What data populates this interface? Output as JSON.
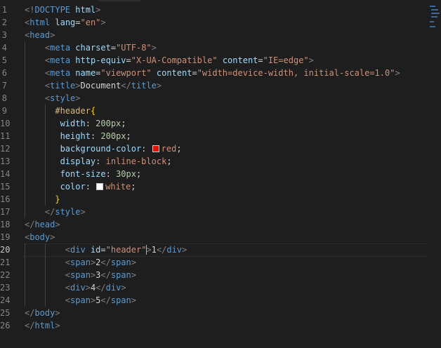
{
  "editor": {
    "active_line": 20,
    "lines": [
      {
        "n": "1",
        "tokens": [
          {
            "t": "<!",
            "c": "t-punct"
          },
          {
            "t": "DOCTYPE",
            "c": "t-doctype"
          },
          {
            "t": " html",
            "c": "t-attr"
          },
          {
            "t": ">",
            "c": "t-punct"
          }
        ]
      },
      {
        "n": "2",
        "tokens": [
          {
            "t": "<",
            "c": "t-punct"
          },
          {
            "t": "html",
            "c": "t-tag"
          },
          {
            "t": " lang",
            "c": "t-attr"
          },
          {
            "t": "=",
            "c": "t-text"
          },
          {
            "t": "\"en\"",
            "c": "t-str"
          },
          {
            "t": ">",
            "c": "t-punct"
          }
        ]
      },
      {
        "n": "3",
        "tokens": [
          {
            "t": "<",
            "c": "t-punct"
          },
          {
            "t": "head",
            "c": "t-tag"
          },
          {
            "t": ">",
            "c": "t-punct"
          }
        ]
      },
      {
        "n": "4",
        "tokens": [
          {
            "t": "    ",
            "c": "t-text"
          },
          {
            "t": "<",
            "c": "t-punct"
          },
          {
            "t": "meta",
            "c": "t-tag"
          },
          {
            "t": " charset",
            "c": "t-attr"
          },
          {
            "t": "=",
            "c": "t-text"
          },
          {
            "t": "\"UTF-8\"",
            "c": "t-str"
          },
          {
            "t": ">",
            "c": "t-punct"
          }
        ]
      },
      {
        "n": "5",
        "tokens": [
          {
            "t": "    ",
            "c": "t-text"
          },
          {
            "t": "<",
            "c": "t-punct"
          },
          {
            "t": "meta",
            "c": "t-tag"
          },
          {
            "t": " http-equiv",
            "c": "t-attr"
          },
          {
            "t": "=",
            "c": "t-text"
          },
          {
            "t": "\"X-UA-Compatible\"",
            "c": "t-str"
          },
          {
            "t": " content",
            "c": "t-attr"
          },
          {
            "t": "=",
            "c": "t-text"
          },
          {
            "t": "\"IE=edge\"",
            "c": "t-str"
          },
          {
            "t": ">",
            "c": "t-punct"
          }
        ]
      },
      {
        "n": "6",
        "tokens": [
          {
            "t": "    ",
            "c": "t-text"
          },
          {
            "t": "<",
            "c": "t-punct"
          },
          {
            "t": "meta",
            "c": "t-tag"
          },
          {
            "t": " name",
            "c": "t-attr"
          },
          {
            "t": "=",
            "c": "t-text"
          },
          {
            "t": "\"viewport\"",
            "c": "t-str"
          },
          {
            "t": " content",
            "c": "t-attr"
          },
          {
            "t": "=",
            "c": "t-text"
          },
          {
            "t": "\"width=device-width, initial-scale=1.0\"",
            "c": "t-str"
          },
          {
            "t": ">",
            "c": "t-punct"
          }
        ]
      },
      {
        "n": "7",
        "tokens": [
          {
            "t": "    ",
            "c": "t-text"
          },
          {
            "t": "<",
            "c": "t-punct"
          },
          {
            "t": "title",
            "c": "t-tag"
          },
          {
            "t": ">",
            "c": "t-punct"
          },
          {
            "t": "Document",
            "c": "t-text"
          },
          {
            "t": "</",
            "c": "t-punct"
          },
          {
            "t": "title",
            "c": "t-tag"
          },
          {
            "t": ">",
            "c": "t-punct"
          }
        ]
      },
      {
        "n": "8",
        "tokens": [
          {
            "t": "    ",
            "c": "t-text"
          },
          {
            "t": "<",
            "c": "t-punct"
          },
          {
            "t": "style",
            "c": "t-tag"
          },
          {
            "t": ">",
            "c": "t-punct"
          }
        ]
      },
      {
        "n": "9",
        "tokens": [
          {
            "t": "      ",
            "c": "t-text"
          },
          {
            "t": "#header",
            "c": "t-sel"
          },
          {
            "t": "{",
            "c": "t-brace"
          }
        ]
      },
      {
        "n": "10",
        "tokens": [
          {
            "t": "       ",
            "c": "t-text"
          },
          {
            "t": "width",
            "c": "t-prop"
          },
          {
            "t": ": ",
            "c": "t-text"
          },
          {
            "t": "200px",
            "c": "t-num"
          },
          {
            "t": ";",
            "c": "t-text"
          }
        ]
      },
      {
        "n": "11",
        "tokens": [
          {
            "t": "       ",
            "c": "t-text"
          },
          {
            "t": "height",
            "c": "t-prop"
          },
          {
            "t": ": ",
            "c": "t-text"
          },
          {
            "t": "200px",
            "c": "t-num"
          },
          {
            "t": ";",
            "c": "t-text"
          }
        ]
      },
      {
        "n": "12",
        "tokens": [
          {
            "t": "       ",
            "c": "t-text"
          },
          {
            "t": "background-color",
            "c": "t-prop"
          },
          {
            "t": ": ",
            "c": "t-text"
          },
          {
            "swatch": "#e51400"
          },
          {
            "t": "red",
            "c": "t-val"
          },
          {
            "t": ";",
            "c": "t-text"
          }
        ]
      },
      {
        "n": "13",
        "tokens": [
          {
            "t": "       ",
            "c": "t-text"
          },
          {
            "t": "display",
            "c": "t-prop"
          },
          {
            "t": ": ",
            "c": "t-text"
          },
          {
            "t": "inline-block",
            "c": "t-val"
          },
          {
            "t": ";",
            "c": "t-text"
          }
        ]
      },
      {
        "n": "14",
        "tokens": [
          {
            "t": "       ",
            "c": "t-text"
          },
          {
            "t": "font-size",
            "c": "t-prop"
          },
          {
            "t": ": ",
            "c": "t-text"
          },
          {
            "t": "30px",
            "c": "t-num"
          },
          {
            "t": ";",
            "c": "t-text"
          }
        ]
      },
      {
        "n": "15",
        "tokens": [
          {
            "t": "       ",
            "c": "t-text"
          },
          {
            "t": "color",
            "c": "t-prop"
          },
          {
            "t": ": ",
            "c": "t-text"
          },
          {
            "swatch": "#ffffff"
          },
          {
            "t": "white",
            "c": "t-val"
          },
          {
            "t": ";",
            "c": "t-text"
          }
        ]
      },
      {
        "n": "16",
        "tokens": [
          {
            "t": "      ",
            "c": "t-text"
          },
          {
            "t": "}",
            "c": "t-brace"
          }
        ]
      },
      {
        "n": "17",
        "tokens": [
          {
            "t": "    ",
            "c": "t-text"
          },
          {
            "t": "</",
            "c": "t-punct"
          },
          {
            "t": "style",
            "c": "t-tag"
          },
          {
            "t": ">",
            "c": "t-punct"
          }
        ]
      },
      {
        "n": "18",
        "tokens": [
          {
            "t": "</",
            "c": "t-punct"
          },
          {
            "t": "head",
            "c": "t-tag"
          },
          {
            "t": ">",
            "c": "t-punct"
          }
        ]
      },
      {
        "n": "19",
        "tokens": [
          {
            "t": "<",
            "c": "t-punct"
          },
          {
            "t": "body",
            "c": "t-tag"
          },
          {
            "t": ">",
            "c": "t-punct"
          }
        ]
      },
      {
        "n": "20",
        "tokens": [
          {
            "t": "        ",
            "c": "t-text"
          },
          {
            "t": "<",
            "c": "t-punct"
          },
          {
            "t": "div",
            "c": "t-tag"
          },
          {
            "t": " id",
            "c": "t-attr"
          },
          {
            "t": "=",
            "c": "t-text"
          },
          {
            "t": "\"header\"",
            "c": "t-str"
          },
          {
            "cursor": true
          },
          {
            "t": ">",
            "c": "t-punct"
          },
          {
            "t": "1",
            "c": "t-text"
          },
          {
            "t": "</",
            "c": "t-punct"
          },
          {
            "t": "div",
            "c": "t-tag"
          },
          {
            "t": ">",
            "c": "t-punct"
          }
        ]
      },
      {
        "n": "21",
        "tokens": [
          {
            "t": "        ",
            "c": "t-text"
          },
          {
            "t": "<",
            "c": "t-punct"
          },
          {
            "t": "span",
            "c": "t-tag"
          },
          {
            "t": ">",
            "c": "t-punct"
          },
          {
            "t": "2",
            "c": "t-text"
          },
          {
            "t": "</",
            "c": "t-punct"
          },
          {
            "t": "span",
            "c": "t-tag"
          },
          {
            "t": ">",
            "c": "t-punct"
          }
        ]
      },
      {
        "n": "22",
        "tokens": [
          {
            "t": "        ",
            "c": "t-text"
          },
          {
            "t": "<",
            "c": "t-punct"
          },
          {
            "t": "span",
            "c": "t-tag"
          },
          {
            "t": ">",
            "c": "t-punct"
          },
          {
            "t": "3",
            "c": "t-text"
          },
          {
            "t": "</",
            "c": "t-punct"
          },
          {
            "t": "span",
            "c": "t-tag"
          },
          {
            "t": ">",
            "c": "t-punct"
          }
        ]
      },
      {
        "n": "23",
        "tokens": [
          {
            "t": "        ",
            "c": "t-text"
          },
          {
            "t": "<",
            "c": "t-punct"
          },
          {
            "t": "div",
            "c": "t-tag"
          },
          {
            "t": ">",
            "c": "t-punct"
          },
          {
            "t": "4",
            "c": "t-text"
          },
          {
            "t": "</",
            "c": "t-punct"
          },
          {
            "t": "div",
            "c": "t-tag"
          },
          {
            "t": ">",
            "c": "t-punct"
          }
        ]
      },
      {
        "n": "24",
        "tokens": [
          {
            "t": "        ",
            "c": "t-text"
          },
          {
            "t": "<",
            "c": "t-punct"
          },
          {
            "t": "span",
            "c": "t-tag"
          },
          {
            "t": ">",
            "c": "t-punct"
          },
          {
            "t": "5",
            "c": "t-text"
          },
          {
            "t": "</",
            "c": "t-punct"
          },
          {
            "t": "span",
            "c": "t-tag"
          },
          {
            "t": ">",
            "c": "t-punct"
          }
        ]
      },
      {
        "n": "25",
        "tokens": [
          {
            "t": "</",
            "c": "t-punct"
          },
          {
            "t": "body",
            "c": "t-tag"
          },
          {
            "t": ">",
            "c": "t-punct"
          }
        ]
      },
      {
        "n": "26",
        "tokens": [
          {
            "t": "</",
            "c": "t-punct"
          },
          {
            "t": "html",
            "c": "t-tag"
          },
          {
            "t": ">",
            "c": "t-punct"
          }
        ]
      }
    ]
  },
  "colors": {
    "background": "#1e1e1e",
    "line_number": "#858585",
    "tag": "#569cd6",
    "attribute": "#9cdcfe",
    "string": "#ce9178",
    "selector": "#d7ba7d",
    "number": "#b5cea8",
    "brace": "#ffd700"
  }
}
